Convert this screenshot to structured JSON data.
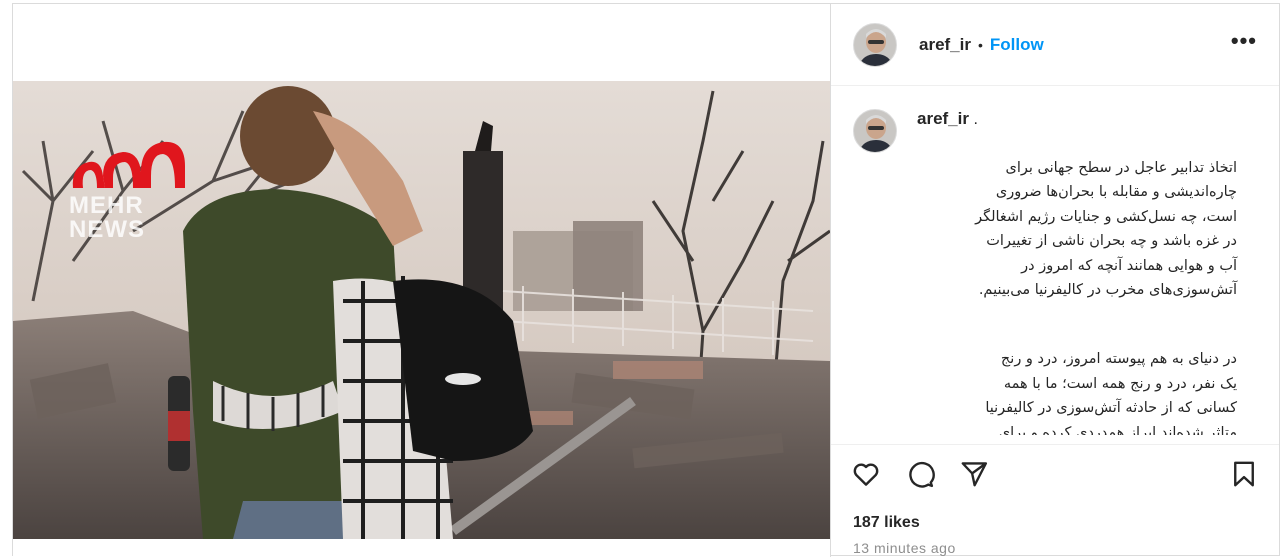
{
  "post": {
    "username": "aref_ir",
    "separator_dot": "•",
    "follow_label": "Follow",
    "more_label": "•••"
  },
  "watermark": {
    "line1": "MEHR",
    "line2": "NEWS",
    "brand_color": "#e0161d"
  },
  "caption": {
    "username": "aref_ir",
    "username_suffix": ".",
    "paragraph1": "اتخاذ تدابیر عاجل در سطح جهانی برای\nچاره‌اندیشی و مقابله با بحران‌ها ضروری\nاست، چه نسل‌کشی و جنایات رژیم اشغالگر\nدر غزه باشد و چه بحران ناشی از تغییرات\nآب و هوایی همانند آنچه که امروز در\nآتش‌سوزی‌های مخرب در کالیفرنیا می‌بینیم.",
    "paragraph2": "در دنیای به هم پیوسته امروز، درد و رنج\nیک نفر، درد و رنج همه است؛ ما با همه\nکسانی که از حادثه آتش‌سوزی در کالیفرنیا\nمتاثر شده‌اند ابراز همدردی کرده و برای\nبهبود سریع اوضاع دعا می‌کنیم."
  },
  "actions": {
    "like_icon": "heart-icon",
    "comment_icon": "comment-icon",
    "share_icon": "share-icon",
    "save_icon": "bookmark-icon"
  },
  "stats": {
    "likes_text": "187 likes",
    "time_text": "13 minutes ago"
  },
  "colors": {
    "follow": "#0095f6",
    "text": "#262626",
    "muted": "#8e8e8e",
    "border": "#dbdbdb"
  }
}
